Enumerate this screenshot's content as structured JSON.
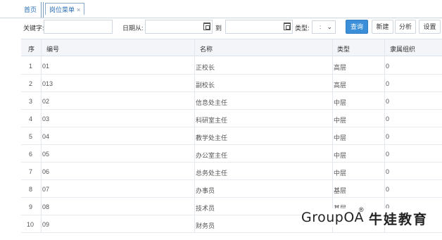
{
  "tabs": {
    "home_label": "首页",
    "active_label": "岗位菜单",
    "close_glyph": "×"
  },
  "search": {
    "keyword_label": "关键字:",
    "keyword_value": "",
    "date_from_label": "日期从:",
    "date_from_value": "",
    "date_to_label": "到",
    "date_to_value": "",
    "type_label": "类型:",
    "type_value": ":",
    "query_button": "查询",
    "new_button": "新建",
    "analyze_button": "分析",
    "settings_button": "设置",
    "accent_color": "#3a8fd8"
  },
  "table": {
    "columns": [
      "序",
      "编号",
      "名称",
      "类型",
      "隶属组织"
    ],
    "rows": [
      {
        "seq": "1",
        "code": "01",
        "name": "正校长",
        "type": "高层",
        "org": "0"
      },
      {
        "seq": "2",
        "code": "013",
        "name": "副校长",
        "type": "高层",
        "org": "0"
      },
      {
        "seq": "3",
        "code": "02",
        "name": "信息处主任",
        "type": "中层",
        "org": "0"
      },
      {
        "seq": "4",
        "code": "03",
        "name": "科研室主任",
        "type": "中层",
        "org": "0"
      },
      {
        "seq": "5",
        "code": "04",
        "name": "教学处主任",
        "type": "中层",
        "org": "0"
      },
      {
        "seq": "6",
        "code": "05",
        "name": "办公室主任",
        "type": "中层",
        "org": "0"
      },
      {
        "seq": "7",
        "code": "06",
        "name": "总务处主任",
        "type": "中层",
        "org": "0"
      },
      {
        "seq": "8",
        "code": "07",
        "name": "办事员",
        "type": "基层",
        "org": "0"
      },
      {
        "seq": "9",
        "code": "08",
        "name": "技术员",
        "type": "基层",
        "org": "0"
      },
      {
        "seq": "10",
        "code": "09",
        "name": "财务员",
        "type": "",
        "org": ""
      }
    ]
  },
  "watermark": {
    "brand_en": "GroupOA",
    "registered": "®",
    "brand_cn": "牛娃教育"
  }
}
